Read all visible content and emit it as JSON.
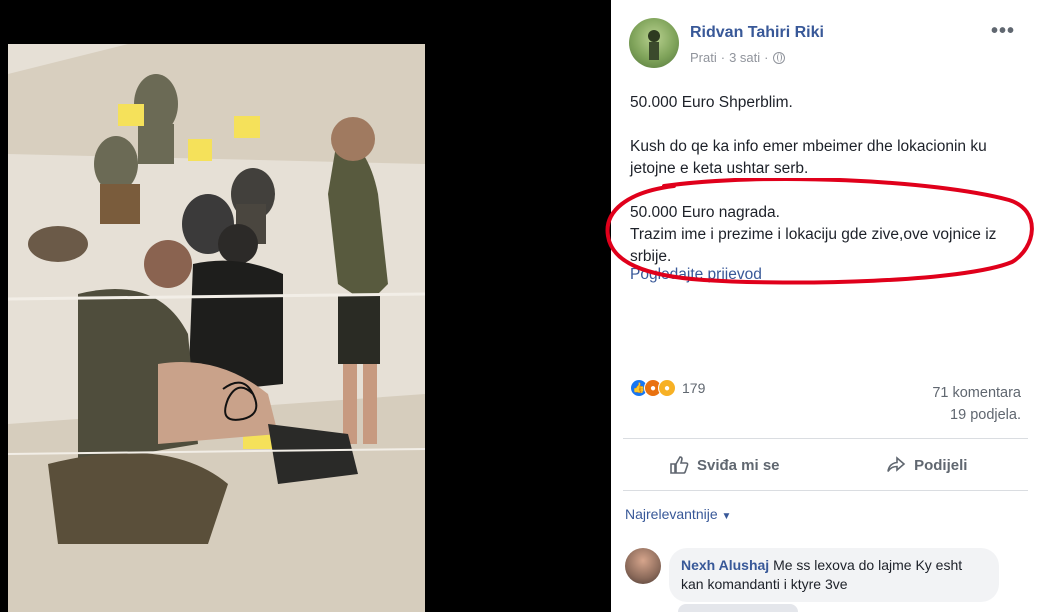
{
  "post": {
    "author": "Ridvan Tahiri Riki",
    "follow": "Prati",
    "time": "3 sati",
    "separator": "·",
    "more": "•••",
    "paragraphs": [
      "50.000 Euro Shperblim.",
      "Kush do qe ka info emer mbeimer dhe lokacionin ku jetojne e keta ushtar serb.",
      "50.000 Euro nagrada.\nTrazim ime i prezime i lokaciju gde zive,ove vojnice iz srbije."
    ],
    "translation_link": "Pogledajte prijevod",
    "reaction_count": "179",
    "comments_count": "71 komentara",
    "shares_count": "19 podjela.",
    "like_label": "Sviđa mi se",
    "share_label": "Podijeli",
    "sort_label": "Najrelevantnije"
  },
  "comment": {
    "name": "Nexh Alushaj",
    "text": "Me ss lexova do lajme Ky esht kan komandanti i ktyre 3ve"
  },
  "colors": {
    "link": "#385898",
    "highlight_circle": "#e0001b",
    "like": "#1877f2"
  },
  "icons": [
    "globe-icon",
    "more-icon",
    "like-icon",
    "share-icon",
    "dropdown-icon"
  ]
}
